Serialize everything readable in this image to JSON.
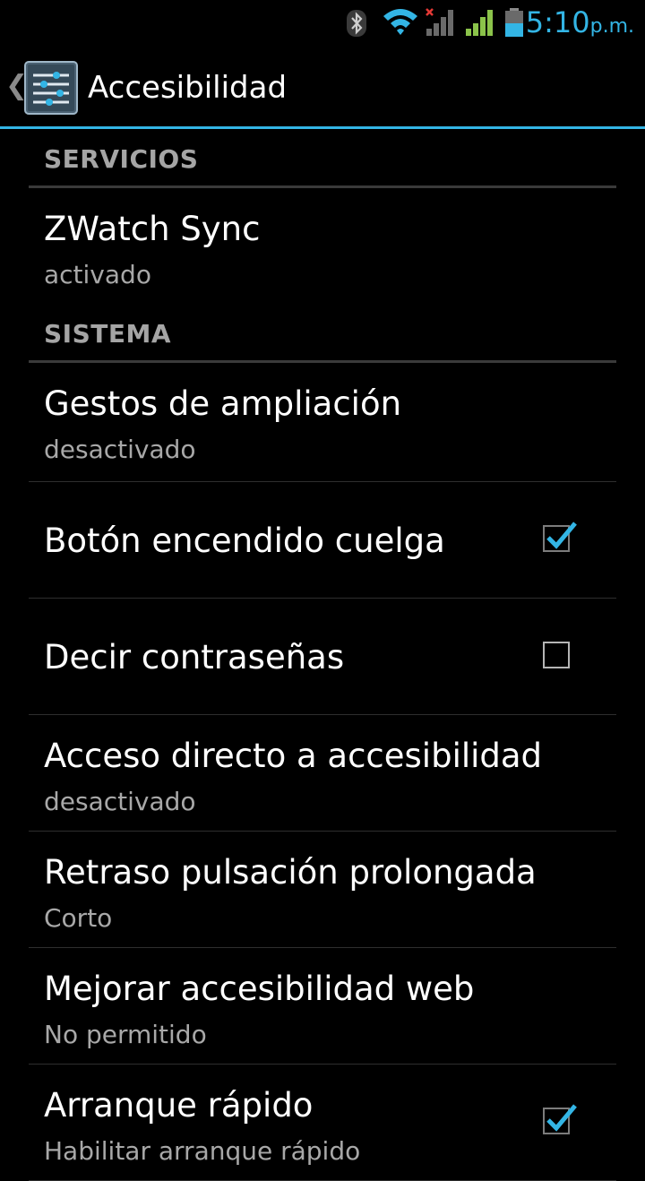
{
  "status_bar": {
    "time": "5:10",
    "ampm": "p.m.",
    "icons": [
      "bluetooth-icon",
      "wifi-icon",
      "signal-no-service-icon",
      "signal-icon",
      "battery-icon"
    ],
    "accent_color": "#33b5e5"
  },
  "action_bar": {
    "back_glyph": "❮",
    "title": "Accesibilidad",
    "app_icon": "accessibility-settings-icon"
  },
  "sections": {
    "services": {
      "header": "SERVICIOS",
      "items": [
        {
          "title": "ZWatch Sync",
          "summary": "activado"
        }
      ]
    },
    "system": {
      "header": "SISTEMA",
      "items": [
        {
          "title": "Gestos de ampliación",
          "summary": "desactivado"
        },
        {
          "title": "Botón encendido cuelga",
          "checked": true
        },
        {
          "title": "Decir contraseñas",
          "checked": false
        },
        {
          "title": "Acceso directo a accesibilidad",
          "summary": "desactivado"
        },
        {
          "title": "Retraso pulsación prolongada",
          "summary": "Corto"
        },
        {
          "title": "Mejorar accesibilidad web",
          "summary": "No permitido"
        },
        {
          "title": "Arranque rápido",
          "summary": "Habilitar arranque rápido",
          "checked": true
        }
      ]
    }
  }
}
